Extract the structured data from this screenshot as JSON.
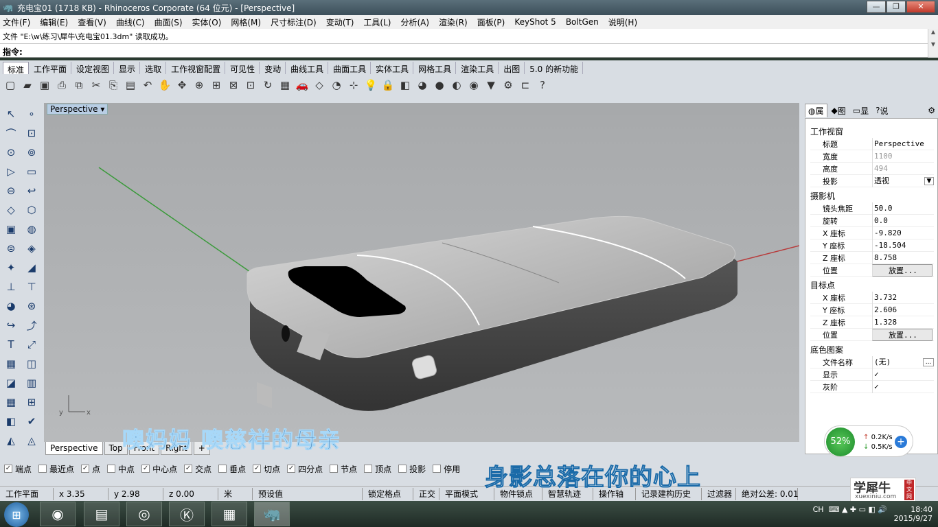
{
  "window": {
    "title": "充电宝01 (1718 KB) - Rhinoceros Corporate (64 位元) - [Perspective]"
  },
  "menu": [
    "文件(F)",
    "编辑(E)",
    "查看(V)",
    "曲线(C)",
    "曲面(S)",
    "实体(O)",
    "网格(M)",
    "尺寸标注(D)",
    "变动(T)",
    "工具(L)",
    "分析(A)",
    "渲染(R)",
    "面板(P)",
    "KeyShot 5",
    "BoltGen",
    "说明(H)"
  ],
  "command": {
    "history": "文件 \"E:\\w\\练习\\犀牛\\充电宝01.3dm\" 读取成功。",
    "prompt": "指令:"
  },
  "toolbar_tabs": [
    "标准",
    "工作平面",
    "设定视图",
    "显示",
    "选取",
    "工作视窗配置",
    "可见性",
    "变动",
    "曲线工具",
    "曲面工具",
    "实体工具",
    "网格工具",
    "渲染工具",
    "出图",
    "5.0 的新功能"
  ],
  "toolbar_icons": [
    "new-icon",
    "open-icon",
    "save-icon",
    "print-icon",
    "import-icon",
    "cut-icon",
    "copy-icon",
    "paste-icon",
    "undo-icon",
    "pan-icon",
    "move-view-icon",
    "zoom-icon",
    "zoom-window-icon",
    "zoom-extents-icon",
    "zoom-selected-icon",
    "rotate-view-icon",
    "four-viewports-icon",
    "car-icon",
    "cplane-icon",
    "circle-tool-icon",
    "snap-icon",
    "light-icon",
    "lock-icon",
    "layer-icon",
    "color-wheel-icon",
    "shade-icon",
    "render-sphere-icon",
    "material-icon",
    "select-arrow-icon",
    "settings-gear-icon",
    "flow-icon",
    "help-icon"
  ],
  "viewport": {
    "name": "Perspective",
    "tabs": [
      "Perspective",
      "Top",
      "Front",
      "Right"
    ],
    "axis_x": "x",
    "axis_y": "y"
  },
  "osnap": [
    {
      "label": "端点",
      "checked": true
    },
    {
      "label": "最近点",
      "checked": false
    },
    {
      "label": "点",
      "checked": true
    },
    {
      "label": "中点",
      "checked": false
    },
    {
      "label": "中心点",
      "checked": true
    },
    {
      "label": "交点",
      "checked": true
    },
    {
      "label": "垂点",
      "checked": false
    },
    {
      "label": "切点",
      "checked": true
    },
    {
      "label": "四分点",
      "checked": true
    },
    {
      "label": "节点",
      "checked": false
    },
    {
      "label": "顶点",
      "checked": false
    },
    {
      "label": "投影",
      "checked": false
    },
    {
      "label": "停用",
      "checked": false
    }
  ],
  "status": [
    "工作平面",
    "x 3.35",
    "y 2.98",
    "z 0.00",
    "米",
    "预设值",
    "锁定格点",
    "正交",
    "平面模式",
    "物件锁点",
    "智慧轨迹",
    "操作轴",
    "记录建构历史",
    "过滤器",
    "绝对公差: 0.01"
  ],
  "panel": {
    "tabs": [
      "属",
      "图",
      "显",
      "说"
    ],
    "viewport_section": "工作视窗",
    "rows1": [
      [
        "标题",
        "Perspective",
        false
      ],
      [
        "宽度",
        "1100",
        true
      ],
      [
        "高度",
        "494",
        true
      ],
      [
        "投影",
        "透视",
        false
      ]
    ],
    "camera_section": "摄影机",
    "rows2": [
      [
        "镜头焦距",
        "50.0"
      ],
      [
        "旋转",
        "0.0"
      ],
      [
        "X 座标",
        "-9.820"
      ],
      [
        "Y 座标",
        "-18.504"
      ],
      [
        "Z 座标",
        "8.758"
      ],
      [
        "位置",
        "放置..."
      ]
    ],
    "target_section": "目标点",
    "rows3": [
      [
        "X 座标",
        "3.732"
      ],
      [
        "Y 座标",
        "2.606"
      ],
      [
        "Z 座标",
        "1.328"
      ],
      [
        "位置",
        "放置..."
      ]
    ],
    "bg_section": "底色图案",
    "rows4": [
      [
        "文件名称",
        "(无)"
      ],
      [
        "显示",
        "✓"
      ],
      [
        "灰阶",
        "✓"
      ]
    ]
  },
  "subtitles": {
    "line1": "噢妈妈 噢慈祥的母亲",
    "line2": "身影总落在你的心上"
  },
  "net": {
    "percent": "52%",
    "up": "0.2K/s",
    "down": "0.5K/s"
  },
  "logo": {
    "big": "学犀牛",
    "small": "xuexiniu.com",
    "tag": "中文网"
  },
  "tray": {
    "lang": "CH",
    "time": "18:40",
    "date": "2015/9/27"
  }
}
